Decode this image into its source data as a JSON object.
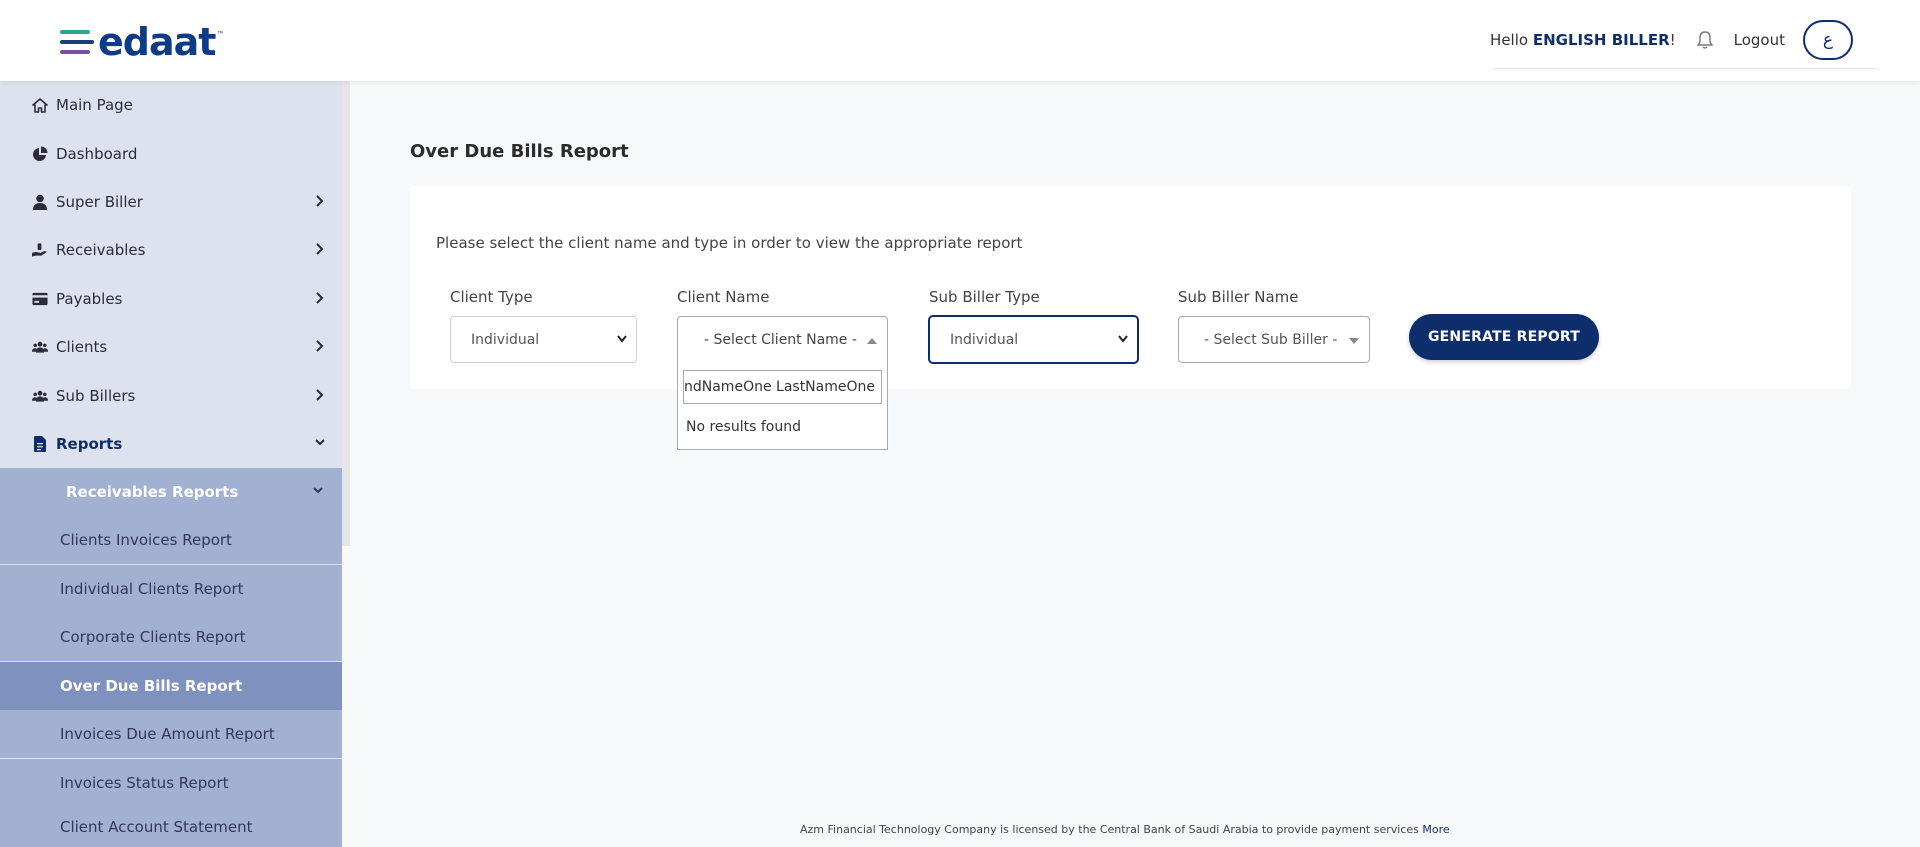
{
  "header": {
    "logo_text": "edaat",
    "logo_tm": "™",
    "greeting": "Hello",
    "user_name": "ENGLISH BILLER",
    "greeting_suffix": "!",
    "logout_label": "Logout",
    "language_toggle": "ع"
  },
  "sidebar": {
    "items": [
      {
        "label": "Main Page",
        "icon": "home-icon"
      },
      {
        "label": "Dashboard",
        "icon": "pie-chart-icon"
      },
      {
        "label": "Super Biller",
        "icon": "user-icon"
      },
      {
        "label": "Receivables",
        "icon": "hand-coin-icon"
      },
      {
        "label": "Payables",
        "icon": "credit-card-icon"
      },
      {
        "label": "Clients",
        "icon": "users-icon"
      },
      {
        "label": "Sub Billers",
        "icon": "users-icon"
      },
      {
        "label": "Reports",
        "icon": "file-icon"
      }
    ],
    "submenu_title": "Receivables Reports",
    "reports": [
      "Clients Invoices Report",
      "Individual Clients Report",
      "Corporate Clients Report",
      "Over Due Bills Report",
      "Invoices Due Amount Report",
      "Invoices Status Report",
      "Client Account Statement"
    ],
    "active_report": "Over Due Bills Report"
  },
  "main": {
    "page_title": "Over Due Bills Report",
    "instructions": "Please select the client name and type in order to view the appropriate report",
    "filters": {
      "client_type_label": "Client Type",
      "client_type_value": "Individual",
      "client_name_label": "Client Name",
      "client_name_value": "- Select Client Name -",
      "sub_biller_type_label": "Sub Biller Type",
      "sub_biller_type_value": "Individual",
      "sub_biller_name_label": "Sub Biller Name",
      "sub_biller_name_value": "- Select Sub Biller -"
    },
    "dropdown": {
      "search_value": "ndNameOne LastNameOne",
      "empty_text": "No results found"
    },
    "generate_button": "GENERATE REPORT"
  },
  "footer": {
    "text": "Azm Financial Technology Company is licensed by the Central Bank of Saudi Arabia to provide payment services",
    "link": "More"
  },
  "colors": {
    "primary": "#0e2e6b",
    "sidebar_bg": "#dde2ee",
    "submenu_bg": "#a2b0d1",
    "active_bg": "#7f92bf"
  }
}
